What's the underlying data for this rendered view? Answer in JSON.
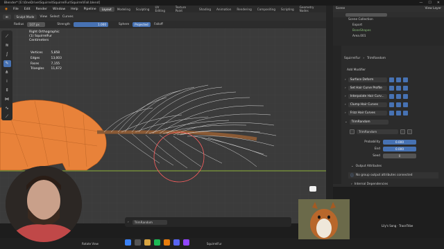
{
  "window": {
    "title": "Blender* [E:\\OneDrive\\Squirrel\\SquirrelFur\\Squirrel\\Fall.blend]",
    "controls": [
      "—",
      "☐",
      "✕"
    ]
  },
  "menubar": {
    "items": [
      "File",
      "Edit",
      "Render",
      "Window",
      "Help",
      "Pipeline"
    ],
    "workspaces": [
      "Layout",
      "Modeling",
      "Sculpting",
      "UV Editing",
      "Texture Paint",
      "Shading",
      "Animation",
      "Rendering",
      "Compositing",
      "Scripting",
      "Geometry Nodes"
    ],
    "active_workspace": "Layout"
  },
  "viewport_header": {
    "mode": "Sculpt Mode",
    "menus": [
      "View",
      "Select",
      "Curves"
    ]
  },
  "tool_settings": {
    "radius_label": "Radius",
    "radius_value": "107 px",
    "strength_label": "Strength",
    "strength_value": "1.000",
    "sphere": "Sphere",
    "projected": "Projected",
    "falloff": "Falloff"
  },
  "overlay": {
    "view_name": "Right Orthographic",
    "object": "(1) SquirrelFur",
    "units": "Centimeters",
    "stats": [
      {
        "label": "Vertices",
        "value": "5,858"
      },
      {
        "label": "Edges",
        "value": "13,003"
      },
      {
        "label": "Faces",
        "value": "7,155"
      },
      {
        "label": "Triangles",
        "value": "11,672"
      }
    ]
  },
  "outliner": {
    "header": "Scene",
    "view_layer": "View Layer",
    "items": [
      {
        "label": "Scene Collection"
      },
      {
        "label": "Export"
      },
      {
        "label": "BoneShapes"
      },
      {
        "label": "Area.001"
      }
    ]
  },
  "properties": {
    "object": "SquirrelFur",
    "modifier": "TrimRandom",
    "add_modifier": "Add Modifier",
    "modifiers": [
      {
        "label": "Surface Deform"
      },
      {
        "label": "Set Hair Curve Profile"
      },
      {
        "label": "Interpolate Hair Curv..."
      },
      {
        "label": "Clump Hair Curves"
      },
      {
        "label": "Frizz Hair Curves"
      },
      {
        "label": "TrimRandom"
      }
    ],
    "node_group": "TrimRandom",
    "inputs": [
      {
        "label": "Probability",
        "value": "0.000"
      },
      {
        "label": "End",
        "value": "0.000"
      },
      {
        "label": "Seed",
        "value": "0"
      }
    ],
    "output_attributes": "Output Attributes",
    "no_outputs": "No group output attributes connected",
    "internal_deps": "Internal Dependencies"
  },
  "bottom_bar": {
    "panel_label": "TrimRandom",
    "status_left": [
      "Rotate View"
    ],
    "right_info": "SquirrelFur"
  },
  "stream_overlay": {
    "music": "Lily's Song · TraceTribe"
  },
  "colors": {
    "accent": "#4772b3",
    "fur": "#e8823a",
    "hair": "#f2f2f2",
    "brush": "#ff6060",
    "ground": "#8fb33a"
  }
}
